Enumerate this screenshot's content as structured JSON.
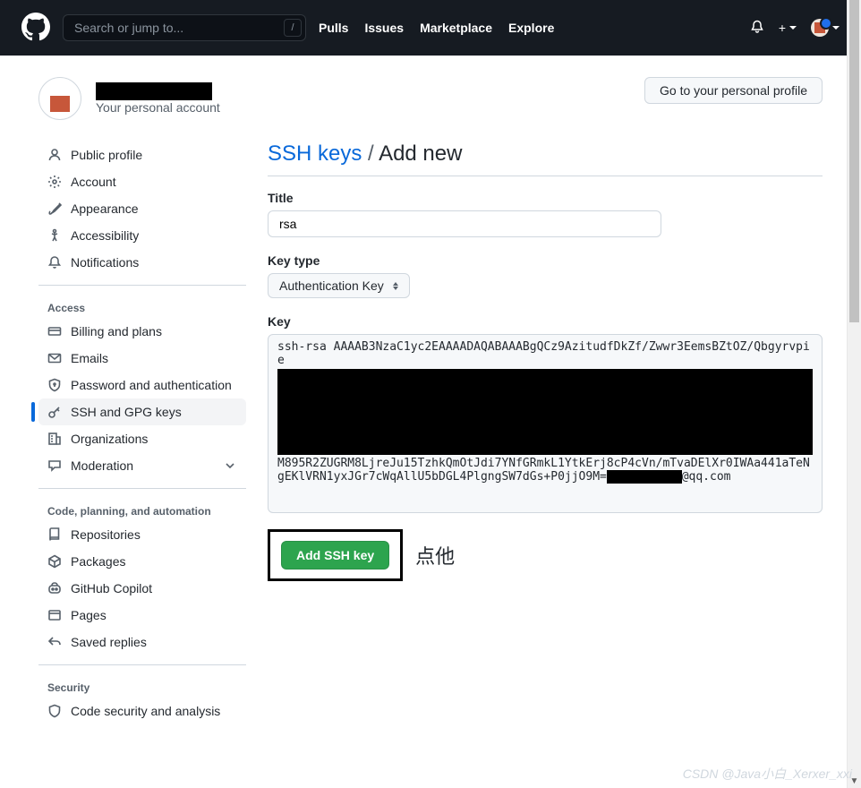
{
  "header": {
    "search_placeholder": "Search or jump to...",
    "slash": "/",
    "nav": {
      "pulls": "Pulls",
      "issues": "Issues",
      "marketplace": "Marketplace",
      "explore": "Explore"
    }
  },
  "account": {
    "subtitle": "Your personal account",
    "profile_button": "Go to your personal profile"
  },
  "sidebar": {
    "public_profile": "Public profile",
    "account": "Account",
    "appearance": "Appearance",
    "accessibility": "Accessibility",
    "notifications": "Notifications",
    "access_header": "Access",
    "billing": "Billing and plans",
    "emails": "Emails",
    "password": "Password and authentication",
    "ssh_gpg": "SSH and GPG keys",
    "organizations": "Organizations",
    "moderation": "Moderation",
    "code_header": "Code, planning, and automation",
    "repositories": "Repositories",
    "packages": "Packages",
    "copilot": "GitHub Copilot",
    "pages": "Pages",
    "saved_replies": "Saved replies",
    "security_header": "Security",
    "code_security": "Code security and analysis"
  },
  "breadcrumb": {
    "link": "SSH keys",
    "sep": "/",
    "current": "Add new"
  },
  "form": {
    "title_label": "Title",
    "title_value": "rsa",
    "keytype_label": "Key type",
    "keytype_value": "Authentication Key",
    "key_label": "Key",
    "key_prefix": "ssh-rsa AAAAB3NzaC1yc2EAAAADAQABAAABgQCz9AzitudfDkZf/Zwwr3EemsBZtOZ/Qbgyrvpie",
    "key_suffix_a": "M895R2ZUGRM8LjreJu15TzhkQmOtJdi7YNfGRmkL1YtkErj8cP4cVn/mTvaDElXr0IWAa441aTeNgEKlVRN1yxJGr7cWqAllU5bDGL4PlgngSW7dGs+P0jjO9M=",
    "key_suffix_b": "@qq.com",
    "submit": "Add SSH key"
  },
  "annotation": "点他",
  "watermark": "CSDN @Java小白_Xerxer_xxi"
}
